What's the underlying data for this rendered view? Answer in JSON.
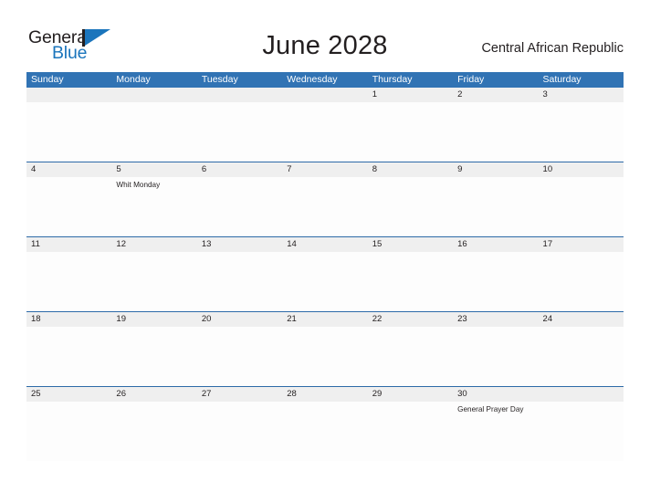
{
  "brand": {
    "name_part1": "General",
    "name_part2": "Blue",
    "logo_icon": "blue-flag-triangle-icon",
    "color_dark": "#231f20",
    "color_blue": "#1b75bc"
  },
  "header": {
    "month_title": "June 2028",
    "country": "Central African Republic"
  },
  "theme": {
    "header_blue": "#3173b4",
    "separator_blue": "#2d6aa8",
    "date_strip_gray": "#efefef",
    "cell_white": "#fdfdfd"
  },
  "calendar": {
    "weekdays": [
      "Sunday",
      "Monday",
      "Tuesday",
      "Wednesday",
      "Thursday",
      "Friday",
      "Saturday"
    ],
    "weeks": [
      {
        "days": [
          {
            "date": "",
            "events": []
          },
          {
            "date": "",
            "events": []
          },
          {
            "date": "",
            "events": []
          },
          {
            "date": "",
            "events": []
          },
          {
            "date": "1",
            "events": []
          },
          {
            "date": "2",
            "events": []
          },
          {
            "date": "3",
            "events": []
          }
        ]
      },
      {
        "days": [
          {
            "date": "4",
            "events": []
          },
          {
            "date": "5",
            "events": [
              "Whit Monday"
            ]
          },
          {
            "date": "6",
            "events": []
          },
          {
            "date": "7",
            "events": []
          },
          {
            "date": "8",
            "events": []
          },
          {
            "date": "9",
            "events": []
          },
          {
            "date": "10",
            "events": []
          }
        ]
      },
      {
        "days": [
          {
            "date": "11",
            "events": []
          },
          {
            "date": "12",
            "events": []
          },
          {
            "date": "13",
            "events": []
          },
          {
            "date": "14",
            "events": []
          },
          {
            "date": "15",
            "events": []
          },
          {
            "date": "16",
            "events": []
          },
          {
            "date": "17",
            "events": []
          }
        ]
      },
      {
        "days": [
          {
            "date": "18",
            "events": []
          },
          {
            "date": "19",
            "events": []
          },
          {
            "date": "20",
            "events": []
          },
          {
            "date": "21",
            "events": []
          },
          {
            "date": "22",
            "events": []
          },
          {
            "date": "23",
            "events": []
          },
          {
            "date": "24",
            "events": []
          }
        ]
      },
      {
        "days": [
          {
            "date": "25",
            "events": []
          },
          {
            "date": "26",
            "events": []
          },
          {
            "date": "27",
            "events": []
          },
          {
            "date": "28",
            "events": []
          },
          {
            "date": "29",
            "events": []
          },
          {
            "date": "30",
            "events": [
              "General Prayer Day"
            ]
          },
          {
            "date": "",
            "events": []
          }
        ]
      }
    ]
  }
}
